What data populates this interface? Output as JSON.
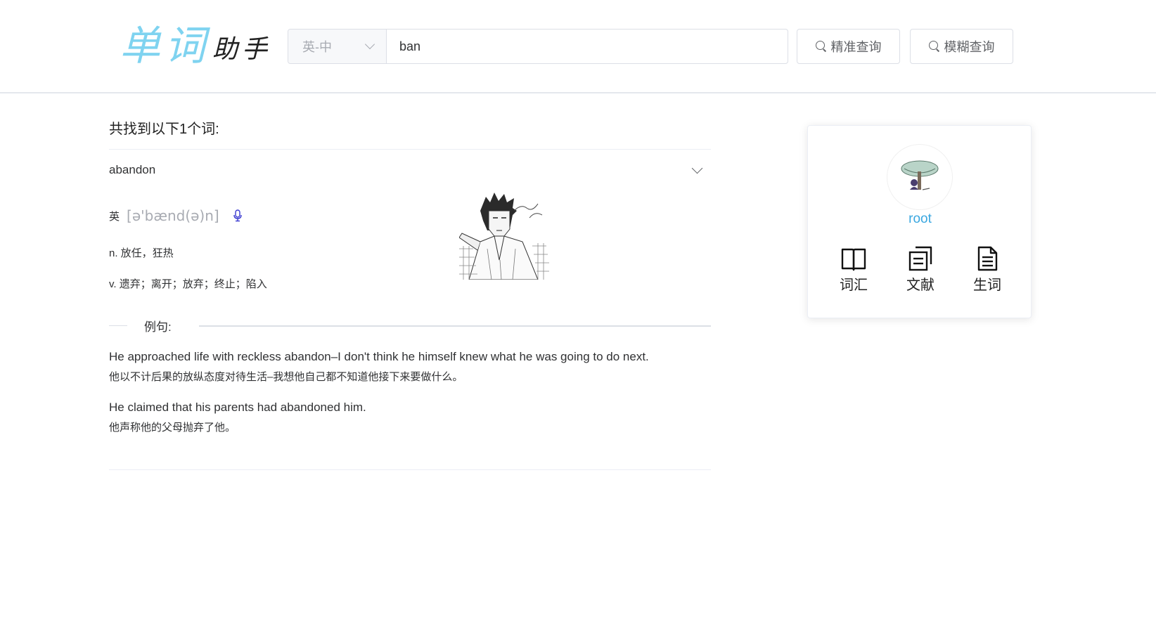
{
  "logo": {
    "main": "单词",
    "sub": "助手"
  },
  "search": {
    "language": "英-中",
    "query": "ban",
    "exact_label": "精准查询",
    "fuzzy_label": "模糊查询"
  },
  "results": {
    "found_text": "共找到以下1个词:",
    "word": "abandon",
    "phonetic_lang": "英",
    "phonetic": "[ə'bænd(ə)n]",
    "definitions": [
      "n. 放任，狂热",
      "v. 遗弃；离开；放弃；终止；陷入"
    ],
    "examples_label": "例句:",
    "examples": [
      {
        "en": "He approached life with reckless abandon–I don't think he himself knew what he was going to do next.",
        "zh": "他以不计后果的放纵态度对待生活–我想他自己都不知道他接下来要做什么。"
      },
      {
        "en": "He claimed that his parents had abandoned him.",
        "zh": "他声称他的父母抛弃了他。"
      }
    ]
  },
  "profile": {
    "username": "root",
    "nav": [
      {
        "label": "词汇",
        "icon": "book-icon"
      },
      {
        "label": "文献",
        "icon": "documents-icon"
      },
      {
        "label": "生词",
        "icon": "document-icon"
      }
    ]
  },
  "colors": {
    "accent": "#3aa7e0",
    "logo": "#7fd3f0"
  }
}
